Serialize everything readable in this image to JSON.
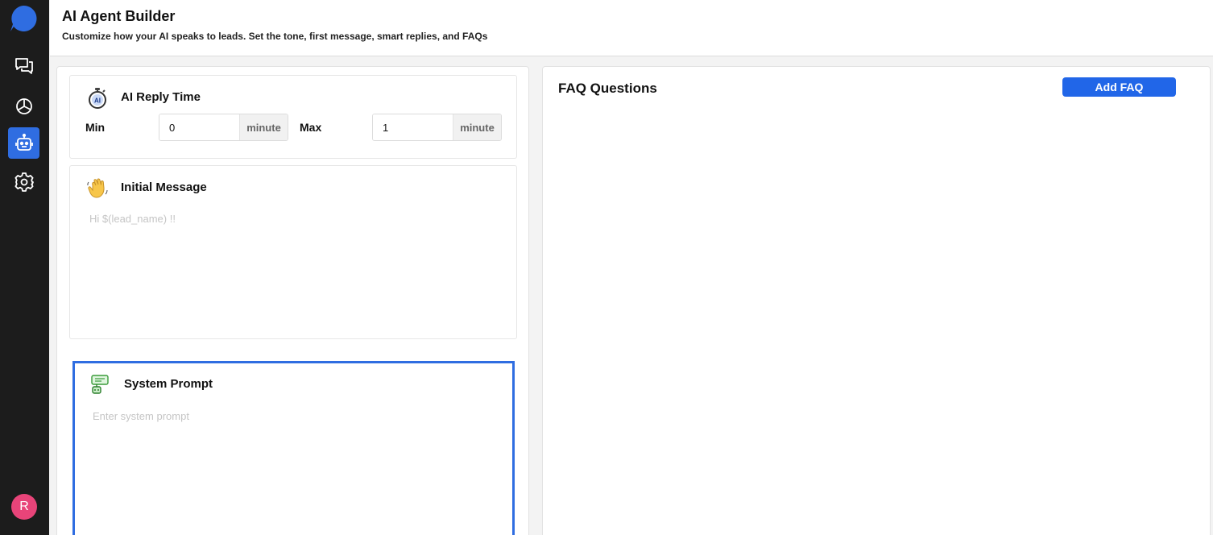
{
  "sidebar": {
    "items": [
      {
        "name": "conversations",
        "icon": "chat-bubbles-icon",
        "active": false
      },
      {
        "name": "analytics",
        "icon": "pie-chart-icon",
        "active": false
      },
      {
        "name": "ai-agent",
        "icon": "robot-icon",
        "active": true
      },
      {
        "name": "settings",
        "icon": "gear-icon",
        "active": false
      }
    ],
    "avatar_initial": "R",
    "avatar_color": "#e84479",
    "active_color": "#2f6de1"
  },
  "header": {
    "title": "AI Agent Builder",
    "subtitle": "Customize how your AI speaks to leads. Set the tone, first message, smart replies, and FAQs"
  },
  "reply_time": {
    "title": "AI Reply Time",
    "icon": "ai-stopwatch-icon",
    "min_label": "Min",
    "min_value": "0",
    "min_unit": "minute",
    "max_label": "Max",
    "max_value": "1",
    "max_unit": "minute"
  },
  "initial_message": {
    "title": "Initial Message",
    "icon": "waving-hand-icon",
    "value": "",
    "placeholder": "Hi $(lead_name) !!"
  },
  "system_prompt": {
    "title": "System Prompt",
    "icon": "robot-chat-icon",
    "value": "",
    "placeholder": "Enter system prompt"
  },
  "faq": {
    "title": "FAQ Questions",
    "add_button_label": "Add FAQ",
    "button_color": "#2166e8",
    "items": []
  }
}
